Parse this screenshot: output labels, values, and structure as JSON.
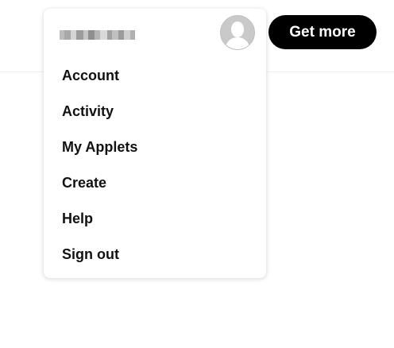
{
  "header": {
    "get_more_label": "Get more"
  },
  "account_menu": {
    "avatar_icon": "user-silhouette",
    "items": [
      {
        "label": "Account"
      },
      {
        "label": "Activity"
      },
      {
        "label": "My Applets"
      },
      {
        "label": "Create"
      },
      {
        "label": "Help"
      },
      {
        "label": "Sign out"
      }
    ]
  }
}
